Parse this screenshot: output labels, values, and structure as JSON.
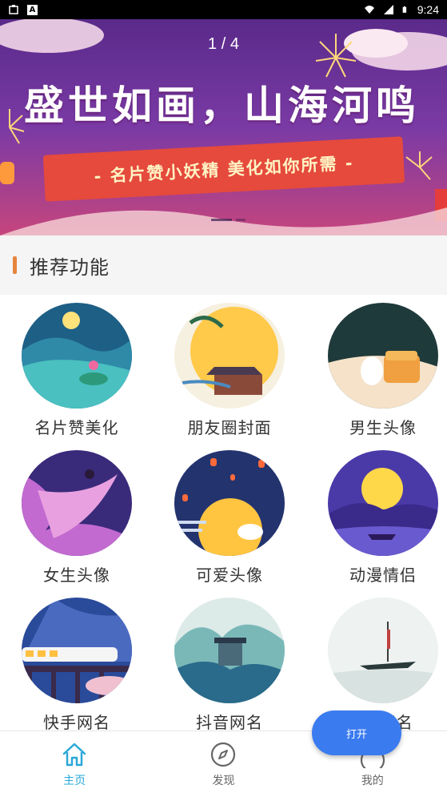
{
  "status_bar": {
    "time": "9:24",
    "icons": [
      "notification-icon",
      "app-a-icon",
      "wifi-icon",
      "signal-icon",
      "battery-icon"
    ]
  },
  "banner": {
    "counter": "1 / 4",
    "title": "盛世如画，山海河鸣",
    "ribbon": "-  名片赞小妖精 美化如你所需  -",
    "current_slide": 1,
    "slide_count": 4
  },
  "section": {
    "title": "推荐功能",
    "accent_color": "#e6843c"
  },
  "features": [
    {
      "label": "名片赞美化",
      "icon": "lotus-lake-moon-image"
    },
    {
      "label": "朋友圈封面",
      "icon": "moon-pavilion-image"
    },
    {
      "label": "男生头像",
      "icon": "rabbit-mooncake-image"
    },
    {
      "label": "女生头像",
      "icon": "fairy-chang-e-image"
    },
    {
      "label": "可爱头像",
      "icon": "lanterns-rabbit-moon-image"
    },
    {
      "label": "动漫情侣",
      "icon": "couple-boat-moon-image"
    },
    {
      "label": "快手网名",
      "icon": "train-bridge-image"
    },
    {
      "label": "抖音网名",
      "icon": "gate-mountains-image"
    },
    {
      "label": "QQ网名",
      "icon": "boat-ink-painting-image"
    }
  ],
  "floating_button": {
    "label": "打开"
  },
  "bottom_nav": [
    {
      "label": "主页",
      "icon": "home-icon",
      "active": true
    },
    {
      "label": "发现",
      "icon": "compass-icon",
      "active": false
    },
    {
      "label": "我的",
      "icon": "profile-icon",
      "active": false
    }
  ],
  "colors": {
    "nav_active": "#2aa8d8",
    "open_button": "#3a7bf0"
  }
}
